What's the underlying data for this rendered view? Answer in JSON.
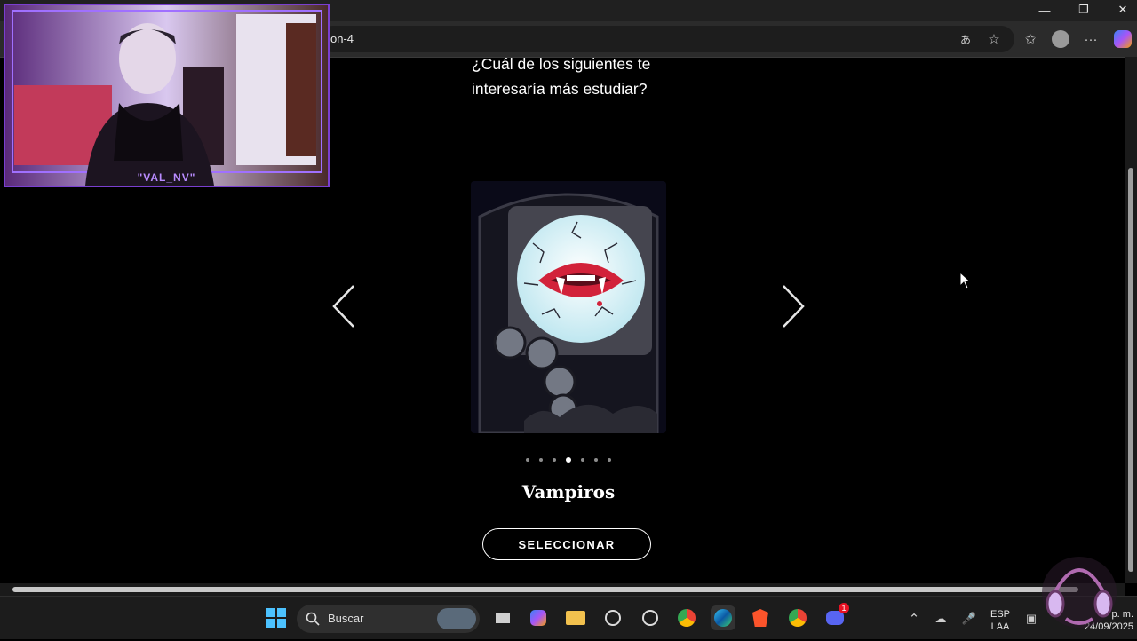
{
  "browser": {
    "url": "on-4",
    "window_controls": [
      "minimize",
      "restore",
      "close"
    ]
  },
  "quiz": {
    "question": "¿Cuál de los siguientes te interesaría más estudiar?",
    "option_title": "Vampiros",
    "select_label": "SELECCIONAR",
    "carousel": {
      "total": 7,
      "active_index": 3
    }
  },
  "webcam": {
    "label": "\"VAL_NV\""
  },
  "taskbar": {
    "search_label": "Buscar",
    "language_top": "ESP",
    "language_bottom": "LAA",
    "time": "p. m.",
    "date": "24/09/2025",
    "discord_badge": "1"
  },
  "colors": {
    "accent_purple": "#7a3fd0",
    "background": "#000000"
  }
}
